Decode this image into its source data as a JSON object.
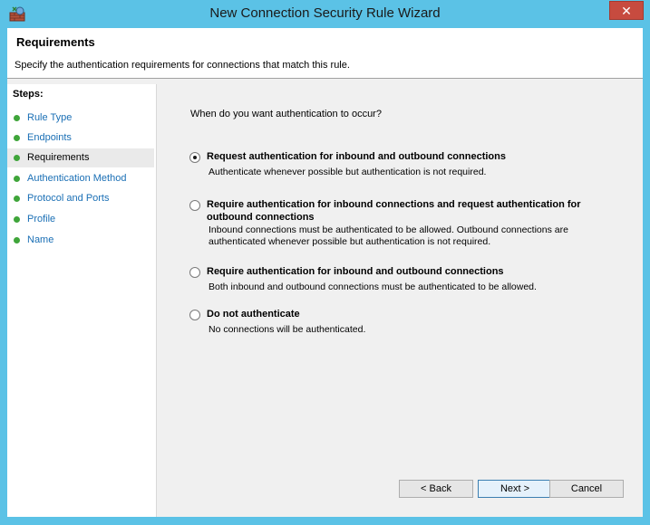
{
  "window": {
    "title": "New Connection Security Rule Wizard",
    "close_glyph": "✕",
    "accent_color": "#5bc2e6"
  },
  "header": {
    "title": "Requirements",
    "description": "Specify the authentication requirements for connections that match this rule."
  },
  "sidebar": {
    "label": "Steps:",
    "items": [
      {
        "label": "Rule Type"
      },
      {
        "label": "Endpoints"
      },
      {
        "label": "Requirements"
      },
      {
        "label": "Authentication Method"
      },
      {
        "label": "Protocol and Ports"
      },
      {
        "label": "Profile"
      },
      {
        "label": "Name"
      }
    ],
    "active_index": 2
  },
  "main": {
    "question": "When do you want authentication to occur?",
    "options": [
      {
        "label": "Request authentication for inbound and outbound connections",
        "description": "Authenticate whenever possible but authentication is not required.",
        "selected": true
      },
      {
        "label": "Require authentication for inbound connections and request authentication for outbound connections",
        "description": "Inbound connections must be authenticated to be allowed. Outbound connections are authenticated whenever possible but authentication is not required.",
        "selected": false
      },
      {
        "label": "Require authentication for inbound and outbound connections",
        "description": "Both inbound and outbound connections must be authenticated to be allowed.",
        "selected": false
      },
      {
        "label": "Do not authenticate",
        "description": "No connections will be authenticated.",
        "selected": false
      }
    ]
  },
  "buttons": {
    "back": "< Back",
    "next": "Next >",
    "cancel": "Cancel"
  }
}
